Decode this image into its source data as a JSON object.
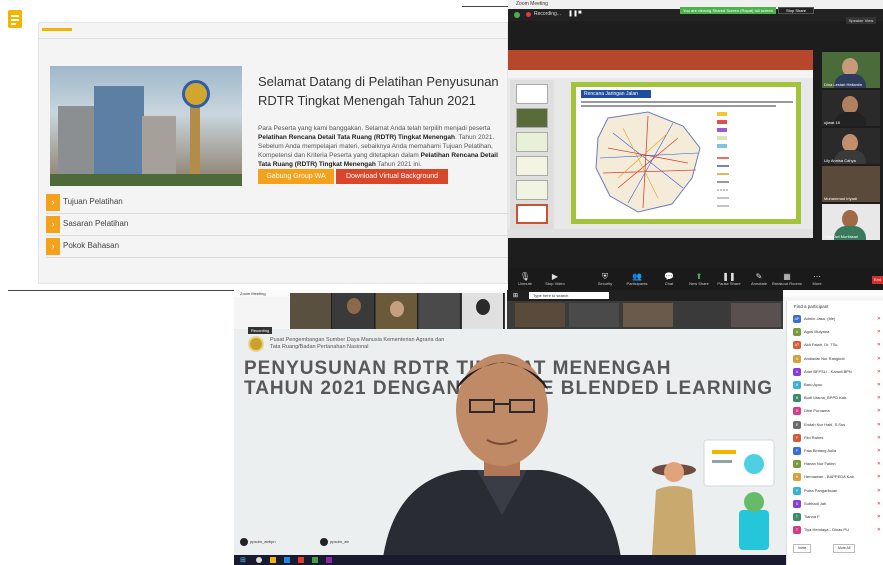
{
  "panel_a": {
    "heading": "Selamat Datang di Pelatihan Penyusunan RDTR Tingkat Menengah Tahun 2021",
    "paragraph_parts": [
      "Para Peserta yang kami banggakan. Selamat Anda telah terpilih menjadi peserta ",
      "Pelatihan Rencana Detail Tata Ruang (RDTR) Tingkat Menengah",
      ". Tahun 2021. Sebelum Anda mempelajari materi, sebaiknya Anda memahami Tujuan Pelatihan, Kompetensi dan Kriteria Peserta yang ditetapkan dalam ",
      "Pelatihan Rencana Detail Tata Ruang (RDTR) Tingkat Menengah",
      " Tahun 2021 ini."
    ],
    "btn_wa": "Gabung Group WA",
    "btn_bg": "Download Virtual Background",
    "accordion": [
      "Tujuan Pelatihan",
      "Sasaran Pelatihan",
      "Pokok Bahasan"
    ],
    "colors": {
      "accent": "#f4a11b",
      "btn_wa": "#f4a11b",
      "btn_bg": "#d9472b"
    }
  },
  "panel_b": {
    "window_title": "Zoom Meeting",
    "recording": "Recording...",
    "share_banner": "You are viewing Shared Screen (Rapat) full screen",
    "stop_share": "Stop Share",
    "speaker_view": "Speaker View",
    "slide_title": "Rencana Jaringan Jalan",
    "gallery": [
      {
        "name": "Dina Lestari Heliantin"
      },
      {
        "name": "ujiwat 18"
      },
      {
        "name": "Lily Annisa Cahya"
      },
      {
        "name": "Muhammad Iriyadi"
      },
      {
        "name": "Yula Dwi Murtiasari"
      }
    ],
    "toolbar": [
      "Unmute",
      "Stop Video",
      "Security",
      "Participants",
      "Chat",
      "New Share",
      "Pause Share",
      "Annotate",
      "Breakout Rooms",
      "More"
    ],
    "end": "End"
  },
  "panel_c": {
    "window_title": "Zoom Meeting",
    "recording": "Recording",
    "search_placeholder": "Type here to search",
    "org_line1": "Pusat Pengembangan Sumber Daya Manusia Kementerian Agraria dan",
    "org_line2": "Tata Ruang/Badan Pertanahan Nasional",
    "title_line1": "PENYUSUNAN RDTR TINGKAT MENENGAH",
    "title_line2": "TAHUN 2021 DENGAN METODE BLENDED LEARNING",
    "social_ig": "ppsdm_atrbpn",
    "social_tw": "ppsdm_atr",
    "participants_header": "Find a participant",
    "participants": [
      {
        "initial": "AP",
        "name": "Admin Jasa, (Me)",
        "color": "#3a6cd6"
      },
      {
        "initial": "A",
        "name": "Agus Mulyana",
        "color": "#7a9a3a"
      },
      {
        "initial": "AT",
        "name": "Aldi Fatah, Dr. TSc",
        "color": "#d65a3a"
      },
      {
        "initial": "A",
        "name": "Andiadar Nur Rangkuti",
        "color": "#d6a03a"
      },
      {
        "initial": "A",
        "name": "Arief BFPSLI - Kanwil BPN",
        "color": "#8a3ad6"
      },
      {
        "initial": "B",
        "name": "Baru Ayuu",
        "color": "#3ab0d6"
      },
      {
        "initial": "B",
        "name": "Budi Utama_BPPD Kab.",
        "color": "#3a8a6c"
      },
      {
        "initial": "D",
        "name": "Dhie Purnama",
        "color": "#d63a8a"
      },
      {
        "initial": "E",
        "name": "Endah Nur Haiti, S.Sos",
        "color": "#6c6c6c"
      },
      {
        "initial": "F",
        "name": "Fitri Rahmi",
        "color": "#d65a3a"
      },
      {
        "initial": "F",
        "name": "Faia Bintang Aulia",
        "color": "#3a6cd6"
      },
      {
        "initial": "H",
        "name": "Hanan Nur Fakhri",
        "color": "#7a9a3a"
      },
      {
        "initial": "H",
        "name": "Hermawan - BAPPEDA Kab.",
        "color": "#d6a03a"
      },
      {
        "initial": "P",
        "name": "Putra Pangaribuan",
        "color": "#3ab0d6"
      },
      {
        "initial": "S",
        "name": "Subhadi Jati",
        "color": "#8a3ad6"
      },
      {
        "initial": "T",
        "name": "Tianna F",
        "color": "#3a8a6c"
      },
      {
        "initial": "T",
        "name": "Tiya Hendaya - Dinas PU",
        "color": "#d63a8a"
      }
    ],
    "btn_invite": "Invite",
    "btn_mute": "Mute All"
  }
}
